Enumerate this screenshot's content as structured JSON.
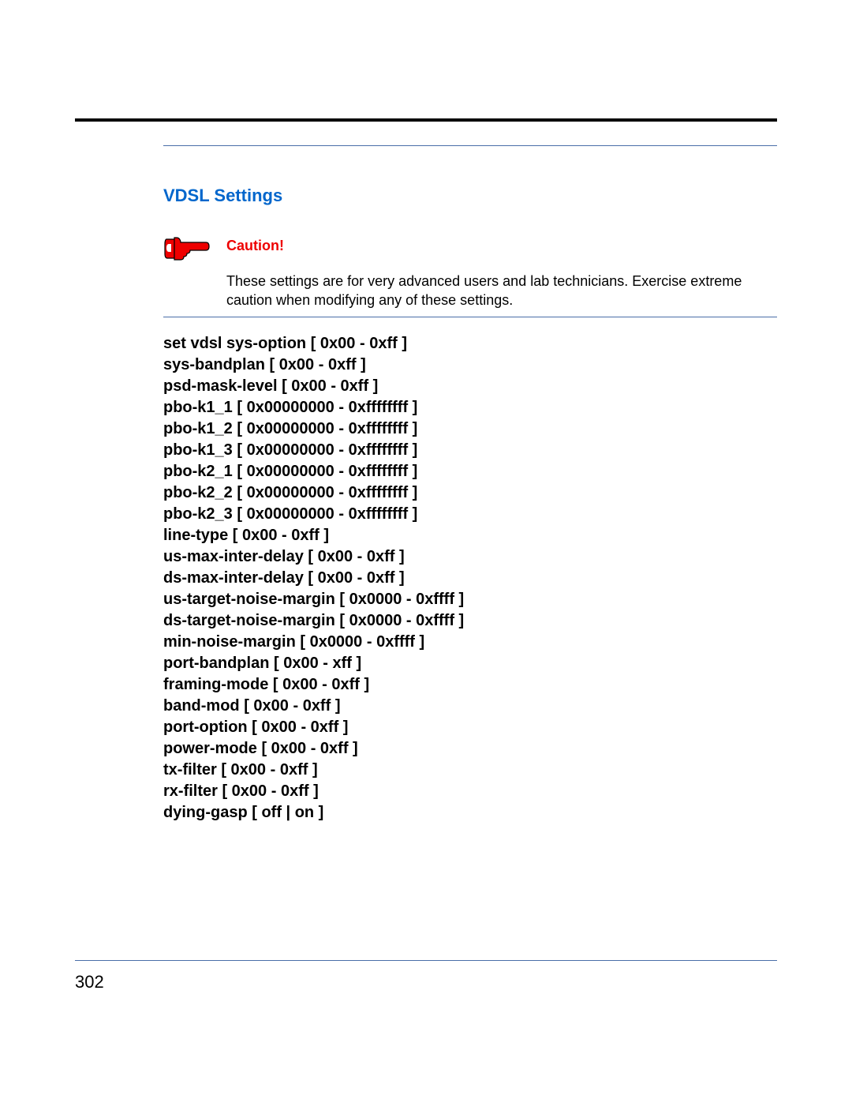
{
  "section_title": "VDSL Settings",
  "caution": {
    "label": "Caution!",
    "text": "These settings are for very advanced users and lab technicians. Exercise extreme caution when modifying any of these settings."
  },
  "commands": [
    "set vdsl sys-option [ 0x00 - 0xff ]",
    "sys-bandplan [ 0x00 - 0xff ]",
    "psd-mask-level [ 0x00 - 0xff ]",
    "pbo-k1_1 [ 0x00000000 - 0xffffffff ]",
    "pbo-k1_2 [ 0x00000000 - 0xffffffff ]",
    "pbo-k1_3 [ 0x00000000 - 0xffffffff ]",
    "pbo-k2_1 [ 0x00000000 - 0xffffffff ]",
    "pbo-k2_2 [ 0x00000000 - 0xffffffff ]",
    "pbo-k2_3 [ 0x00000000 - 0xffffffff ]",
    "line-type [ 0x00 - 0xff ]",
    "us-max-inter-delay [ 0x00 - 0xff ]",
    "ds-max-inter-delay [ 0x00 - 0xff ]",
    "us-target-noise-margin [ 0x0000 - 0xffff ]",
    "ds-target-noise-margin [ 0x0000 - 0xffff ]",
    "min-noise-margin [ 0x0000 - 0xffff ]",
    "port-bandplan [ 0x00 - xff ]",
    "framing-mode [ 0x00 - 0xff ]",
    "band-mod [ 0x00 - 0xff ]",
    "port-option [ 0x00 - 0xff ]",
    "power-mode [ 0x00 - 0xff ]",
    "tx-filter [ 0x00 - 0xff ]",
    "rx-filter [ 0x00 - 0xff ]",
    "dying-gasp [ off | on ]"
  ],
  "page_number": "302"
}
